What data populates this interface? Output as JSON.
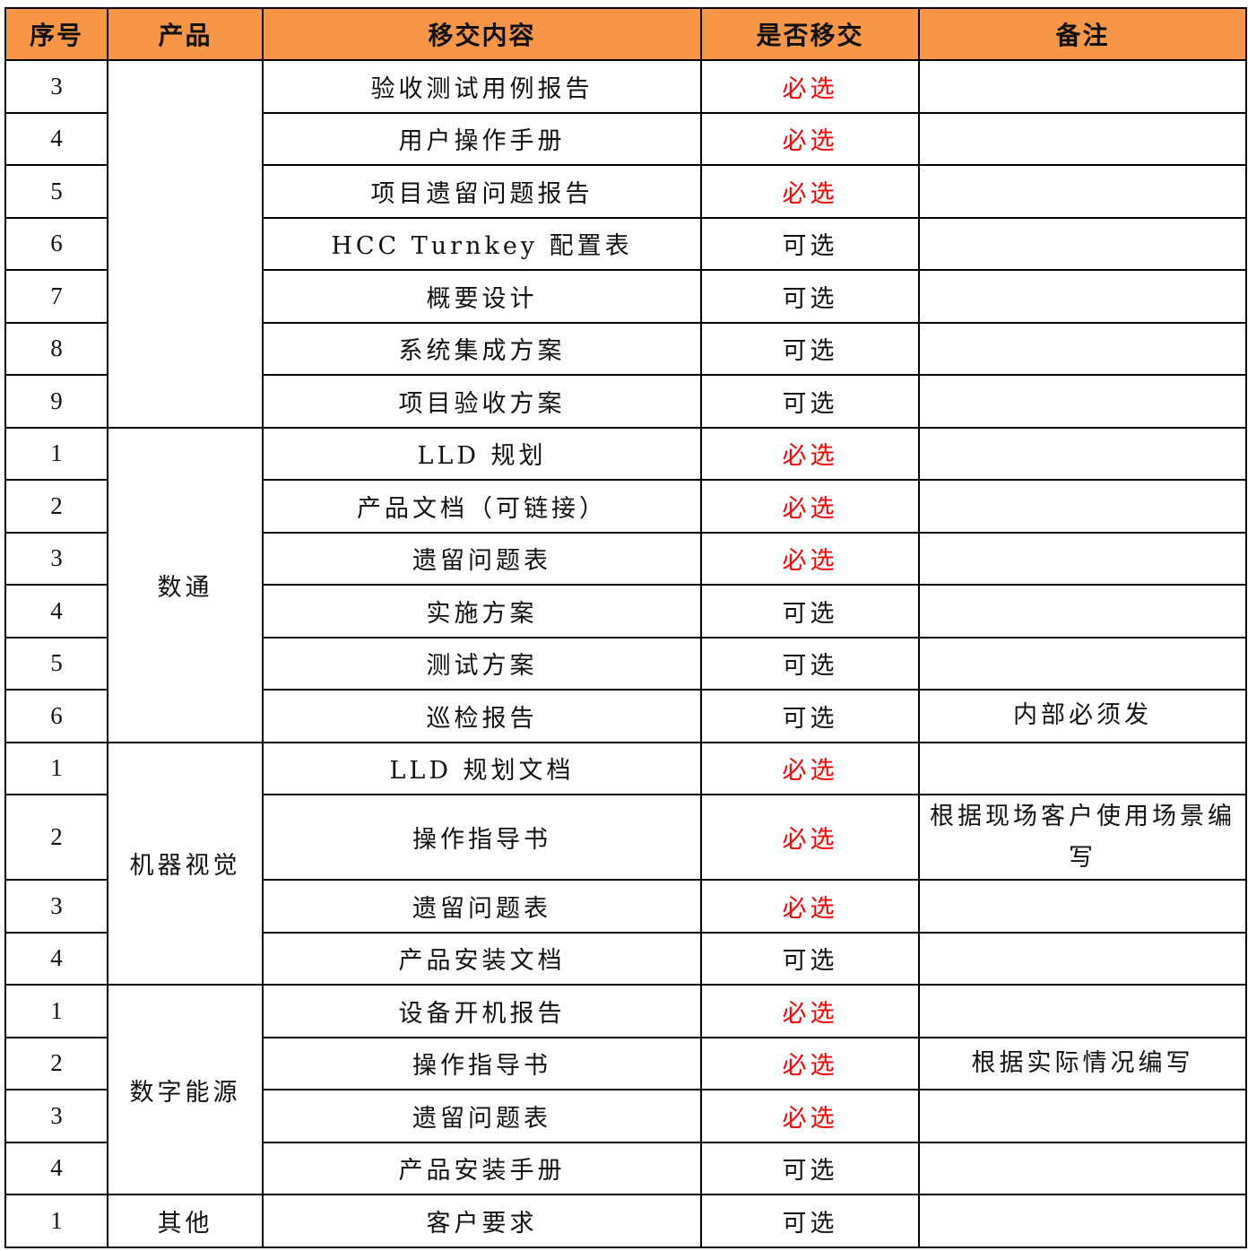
{
  "headers": [
    "序号",
    "产品",
    "移交内容",
    "是否移交",
    "备注"
  ],
  "rows": [
    {
      "no": "3",
      "product": "",
      "content": "验收测试用例报告",
      "status": "必选",
      "note": ""
    },
    {
      "no": "4",
      "content": "用户操作手册",
      "status": "必选",
      "note": ""
    },
    {
      "no": "5",
      "content": "项目遗留问题报告",
      "status": "必选",
      "note": ""
    },
    {
      "no": "6",
      "content": "HCC Turnkey 配置表",
      "status": "可选",
      "note": ""
    },
    {
      "no": "7",
      "content": "概要设计",
      "status": "可选",
      "note": ""
    },
    {
      "no": "8",
      "content": "系统集成方案",
      "status": "可选",
      "note": ""
    },
    {
      "no": "9",
      "content": "项目验收方案",
      "status": "可选",
      "note": ""
    },
    {
      "no": "1",
      "product": "数通",
      "content": "LLD 规划",
      "status": "必选",
      "note": ""
    },
    {
      "no": "2",
      "content": "产品文档（可链接）",
      "status": "必选",
      "note": ""
    },
    {
      "no": "3",
      "content": "遗留问题表",
      "status": "必选",
      "note": ""
    },
    {
      "no": "4",
      "content": "实施方案",
      "status": "可选",
      "note": ""
    },
    {
      "no": "5",
      "content": "测试方案",
      "status": "可选",
      "note": ""
    },
    {
      "no": "6",
      "content": "巡检报告",
      "status": "可选",
      "note": "内部必须发"
    },
    {
      "no": "1",
      "product": "机器视觉",
      "content": "LLD 规划文档",
      "status": "必选",
      "note": ""
    },
    {
      "no": "2",
      "content": "操作指导书",
      "status": "必选",
      "note": "根据现场客户使用场景编写"
    },
    {
      "no": "3",
      "content": "遗留问题表",
      "status": "必选",
      "note": ""
    },
    {
      "no": "4",
      "content": "产品安装文档",
      "status": "可选",
      "note": ""
    },
    {
      "no": "1",
      "product": "数字能源",
      "content": "设备开机报告",
      "status": "必选",
      "note": ""
    },
    {
      "no": "2",
      "content": "操作指导书",
      "status": "必选",
      "note": "根据实际情况编写"
    },
    {
      "no": "3",
      "content": "遗留问题表",
      "status": "必选",
      "note": ""
    },
    {
      "no": "4",
      "content": "产品安装手册",
      "status": "可选",
      "note": ""
    },
    {
      "no": "1",
      "product": "其他",
      "content": "客户要求",
      "status": "可选",
      "note": ""
    }
  ],
  "colors": {
    "header_bg": "#f79646",
    "required_text": "#ff0000"
  }
}
